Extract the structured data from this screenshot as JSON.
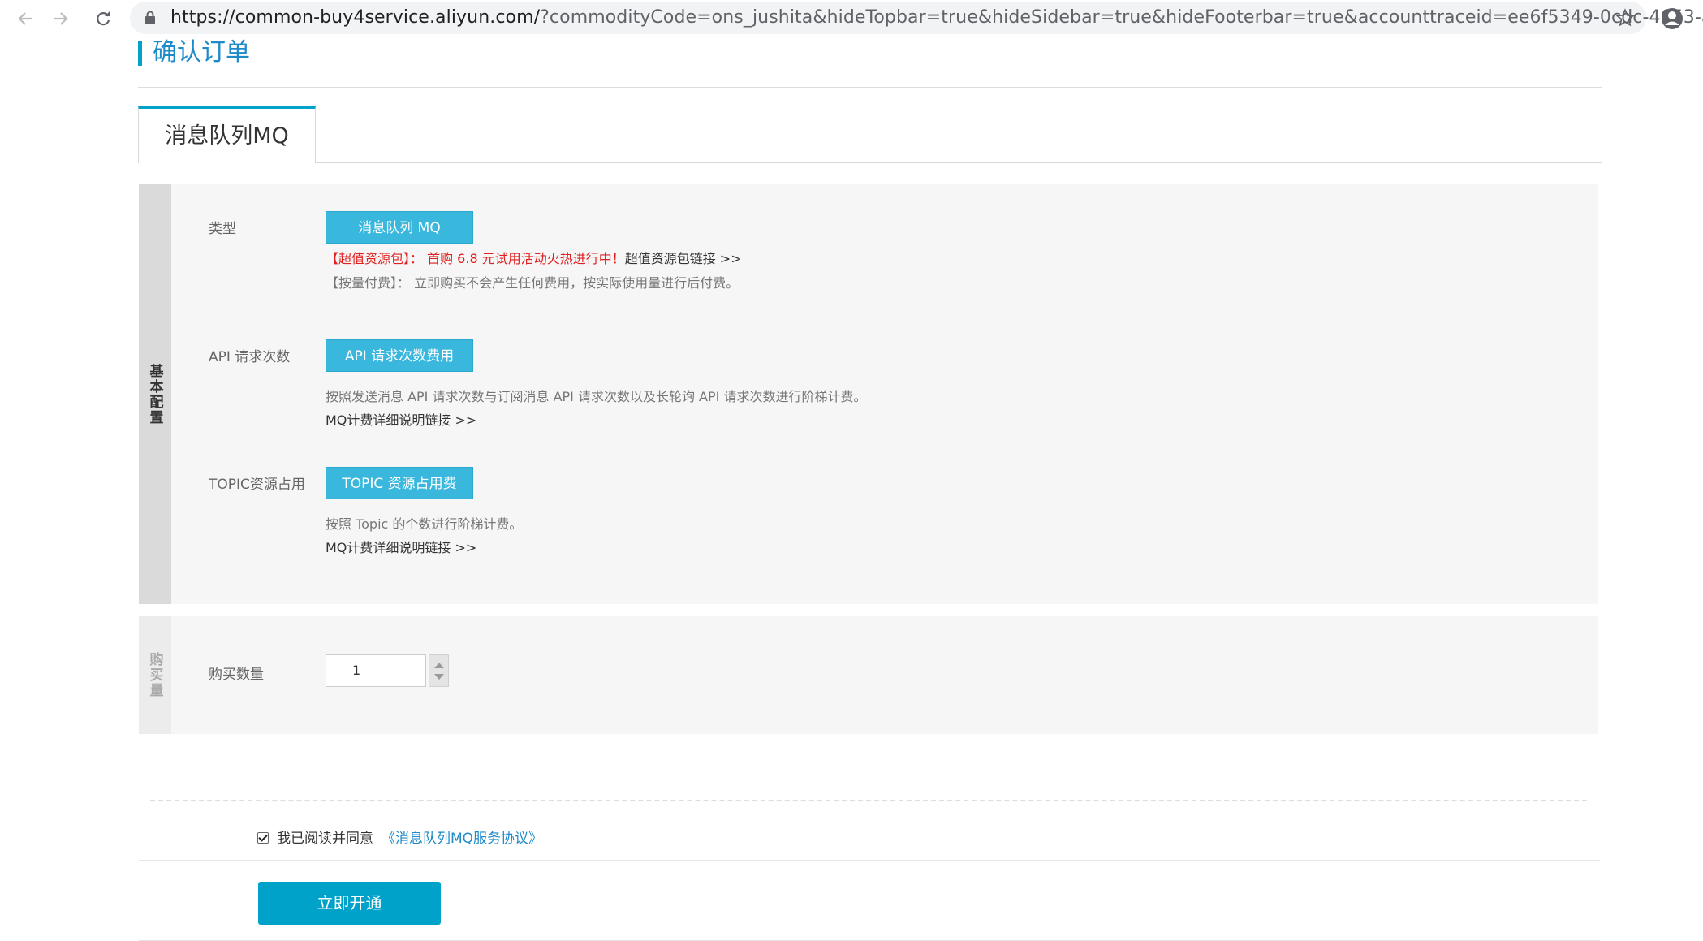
{
  "browser": {
    "url_host": "https://common-buy4service.aliyun.com/",
    "url_rest": "?commodityCode=ons_jushita&hideTopbar=true&hideSidebar=true&hideFooterbar=true&accounttraceid=ee6f5349-0cdc-4653-a..."
  },
  "page": {
    "title": "确认订单",
    "tab_label": "消息队列MQ"
  },
  "basic": {
    "side_label": "基本配置",
    "type_label": "类型",
    "type_value": "消息队列 MQ",
    "promo_prefix": "【超值资源包】： 首购 6.8 元试用活动火热进行中！",
    "promo_link": "超值资源包链接 >>",
    "payg_note": "【按量付费】： 立即购买不会产生任何费用，按实际使用量进行后付费。",
    "api_label": "API 请求次数",
    "api_value": "API 请求次数费用",
    "api_desc": "按照发送消息 API 请求次数与订阅消息 API 请求次数以及长轮询 API 请求次数进行阶梯计费。",
    "api_link": "MQ计费详细说明链接 >>",
    "topic_label": "TOPIC资源占用",
    "topic_value": "TOPIC 资源占用费",
    "topic_desc": "按照 Topic 的个数进行阶梯计费。",
    "topic_link": "MQ计费详细说明链接 >>"
  },
  "quantity": {
    "side_label": "购买量",
    "label": "购买数量",
    "value": "1"
  },
  "agreement": {
    "text": "我已阅读并同意",
    "link": "《消息队列MQ服务协议》",
    "checked": true
  },
  "submit_label": "立即开通",
  "colors": {
    "accent": "#00a2ca",
    "pill": "#39b7dd",
    "promo": "#e02020",
    "link": "#1f8ac9"
  }
}
